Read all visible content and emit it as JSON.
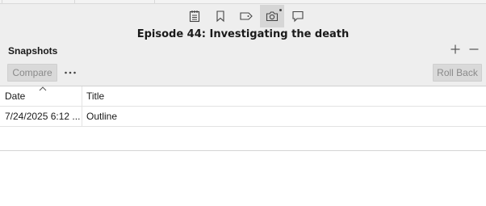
{
  "inspector": {
    "tabs": [
      {
        "icon": "notes-icon",
        "active": false
      },
      {
        "icon": "bookmark-icon",
        "active": false
      },
      {
        "icon": "tag-icon",
        "active": false
      },
      {
        "icon": "camera-icon",
        "active": true
      },
      {
        "icon": "comment-icon",
        "active": false
      }
    ],
    "document_title": "Episode 44: Investigating the death"
  },
  "snapshots": {
    "label": "Snapshots",
    "compare_label": "Compare",
    "rollback_label": "Roll Back",
    "columns": [
      "Date",
      "Title"
    ],
    "rows": [
      {
        "date": "7/24/2025 6:12 ...",
        "title": "Outline"
      }
    ]
  },
  "colors": {
    "panel_bg": "#eeeeee",
    "active_tab": "#d6d6d6",
    "disabled_button": "#d9d9d9",
    "disabled_text": "#8a8a8a"
  }
}
